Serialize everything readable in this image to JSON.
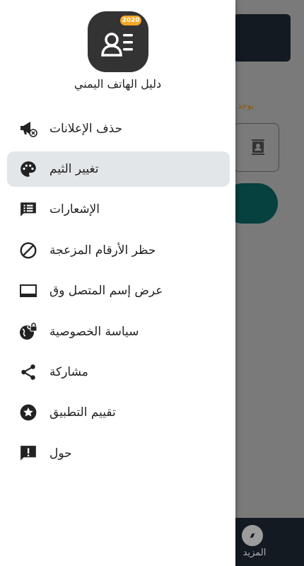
{
  "app": {
    "title": "دليل الهاتف اليمني",
    "badge": "2020"
  },
  "menu": [
    {
      "label": "حذف الإعلانات",
      "icon": "remove-ads-icon"
    },
    {
      "label": "تغيير الثيم",
      "icon": "palette-icon",
      "active": true
    },
    {
      "label": "الإشعارات",
      "icon": "notifications-icon"
    },
    {
      "label": "حظر الأرقام المزعجة",
      "icon": "block-icon"
    },
    {
      "label": "عرض إسم المتصل وق",
      "icon": "caller-id-icon"
    },
    {
      "label": "سياسة الخصوصية",
      "icon": "privacy-icon"
    },
    {
      "label": "مشاركة",
      "icon": "share-icon"
    },
    {
      "label": "تقييم التطبيق",
      "icon": "star-icon"
    },
    {
      "label": "حول",
      "icon": "about-icon"
    }
  ],
  "background": {
    "hint": "يوجد",
    "bottom_nav_label": "المزيد"
  },
  "colors": {
    "active_bg": "#e3e6e9",
    "badge": "#f5a623",
    "teal": "#06403f",
    "dark": "#141a22"
  }
}
